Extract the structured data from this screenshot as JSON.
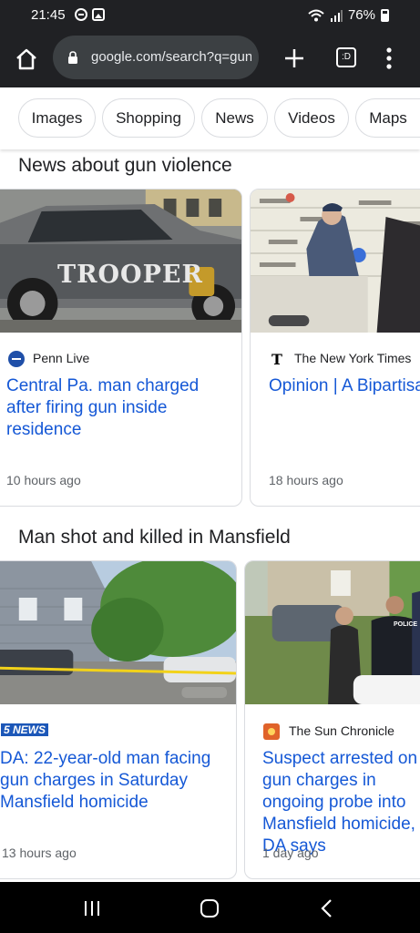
{
  "status_bar": {
    "time": "21:45",
    "battery": "76%"
  },
  "browser": {
    "url": "google.com/search?q=gun",
    "tab_count_label": ":D"
  },
  "chips": [
    "Images",
    "Shopping",
    "News",
    "Videos",
    "Maps"
  ],
  "sections": [
    {
      "title": "News about gun violence",
      "cards": [
        {
          "source": "Penn Live",
          "headline": "Central Pa. man charged after firing gun inside residence",
          "age": "10 hours ago",
          "image_text": "TROOPER"
        },
        {
          "source": "The New York Times",
          "headline": "Opinion | A Bipartisan Gun Control Measure",
          "age": "18 hours ago"
        }
      ]
    },
    {
      "title": "Man shot and killed in Mansfield",
      "cards": [
        {
          "source": "5 NEWS",
          "headline": "DA: 22-year-old man facing gun charges in Saturday Mansfield homicide",
          "age": "13 hours ago"
        },
        {
          "source": "The Sun Chronicle",
          "headline": "Suspect arrested on gun charges in ongoing probe into Mansfield homicide, DA says",
          "age": "1 day ago",
          "image_text": "POLICE"
        }
      ]
    }
  ],
  "colors": {
    "headline": "#1558d6",
    "chrome_dark": "#202124"
  }
}
